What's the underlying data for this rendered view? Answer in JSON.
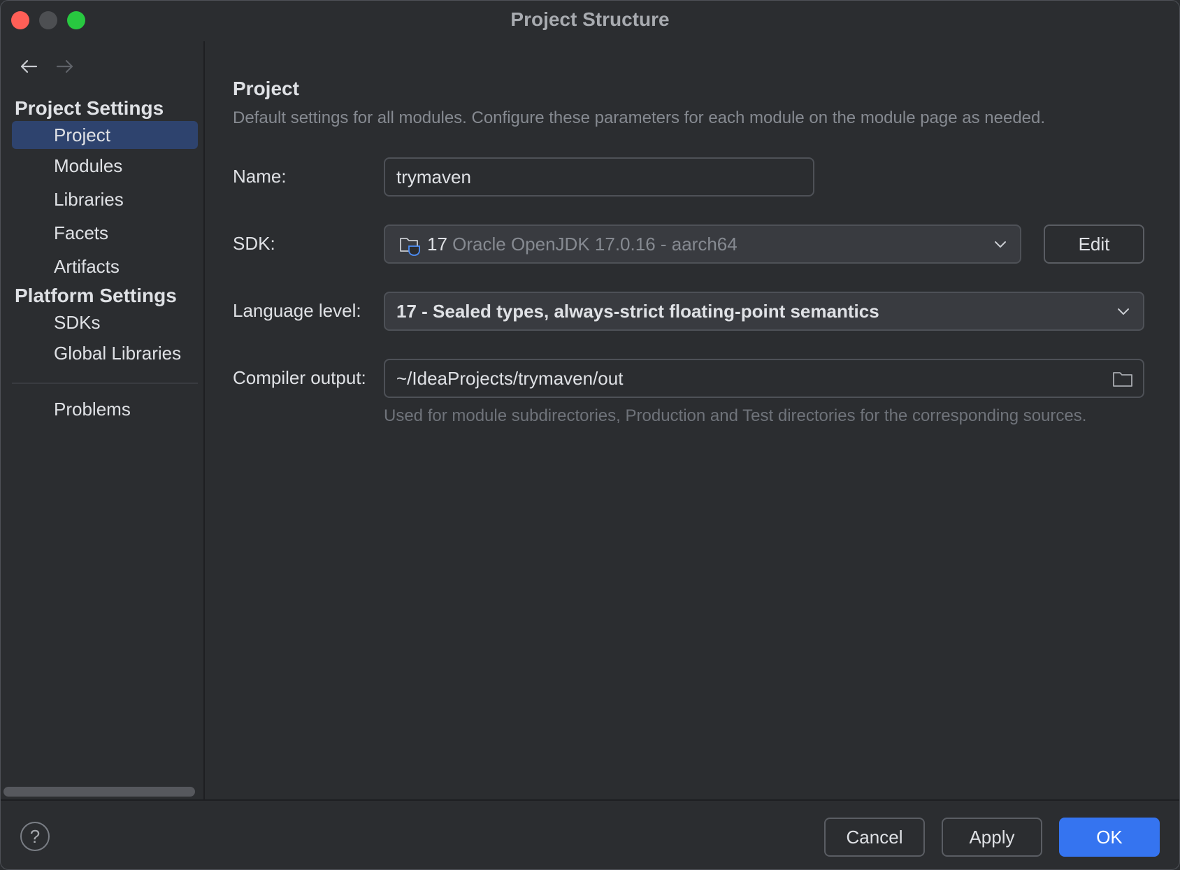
{
  "window": {
    "title": "Project Structure"
  },
  "sidebar": {
    "project_settings_title": "Project Settings",
    "project_items": [
      {
        "label": "Project",
        "selected": true
      },
      {
        "label": "Modules"
      },
      {
        "label": "Libraries"
      },
      {
        "label": "Facets"
      },
      {
        "label": "Artifacts"
      }
    ],
    "platform_settings_title": "Platform Settings",
    "platform_items": [
      {
        "label": "SDKs"
      },
      {
        "label": "Global Libraries"
      }
    ],
    "other_items": [
      {
        "label": "Problems"
      }
    ]
  },
  "main": {
    "title": "Project",
    "description": "Default settings for all modules. Configure these parameters for each module on the module page as needed.",
    "name": {
      "label": "Name:",
      "value": "trymaven"
    },
    "sdk": {
      "label": "SDK:",
      "version": "17",
      "name": "Oracle OpenJDK 17.0.16 - aarch64",
      "edit_label": "Edit"
    },
    "language_level": {
      "label": "Language level:",
      "value": "17 - Sealed types, always-strict floating-point semantics"
    },
    "compiler_output": {
      "label": "Compiler output:",
      "value": "~/IdeaProjects/trymaven/out",
      "hint": "Used for module subdirectories, Production and Test directories for the corresponding sources."
    }
  },
  "footer": {
    "help_label": "?",
    "cancel_label": "Cancel",
    "apply_label": "Apply",
    "ok_label": "OK"
  },
  "colors": {
    "background": "#2b2d30",
    "selection": "#2e436e",
    "primary_button": "#3574f0",
    "close": "#ff5f57",
    "maximize": "#28c840"
  },
  "icons": [
    "back-arrow-icon",
    "forward-arrow-icon",
    "jdk-folder-icon",
    "chevron-down-icon",
    "folder-icon",
    "help-icon"
  ]
}
